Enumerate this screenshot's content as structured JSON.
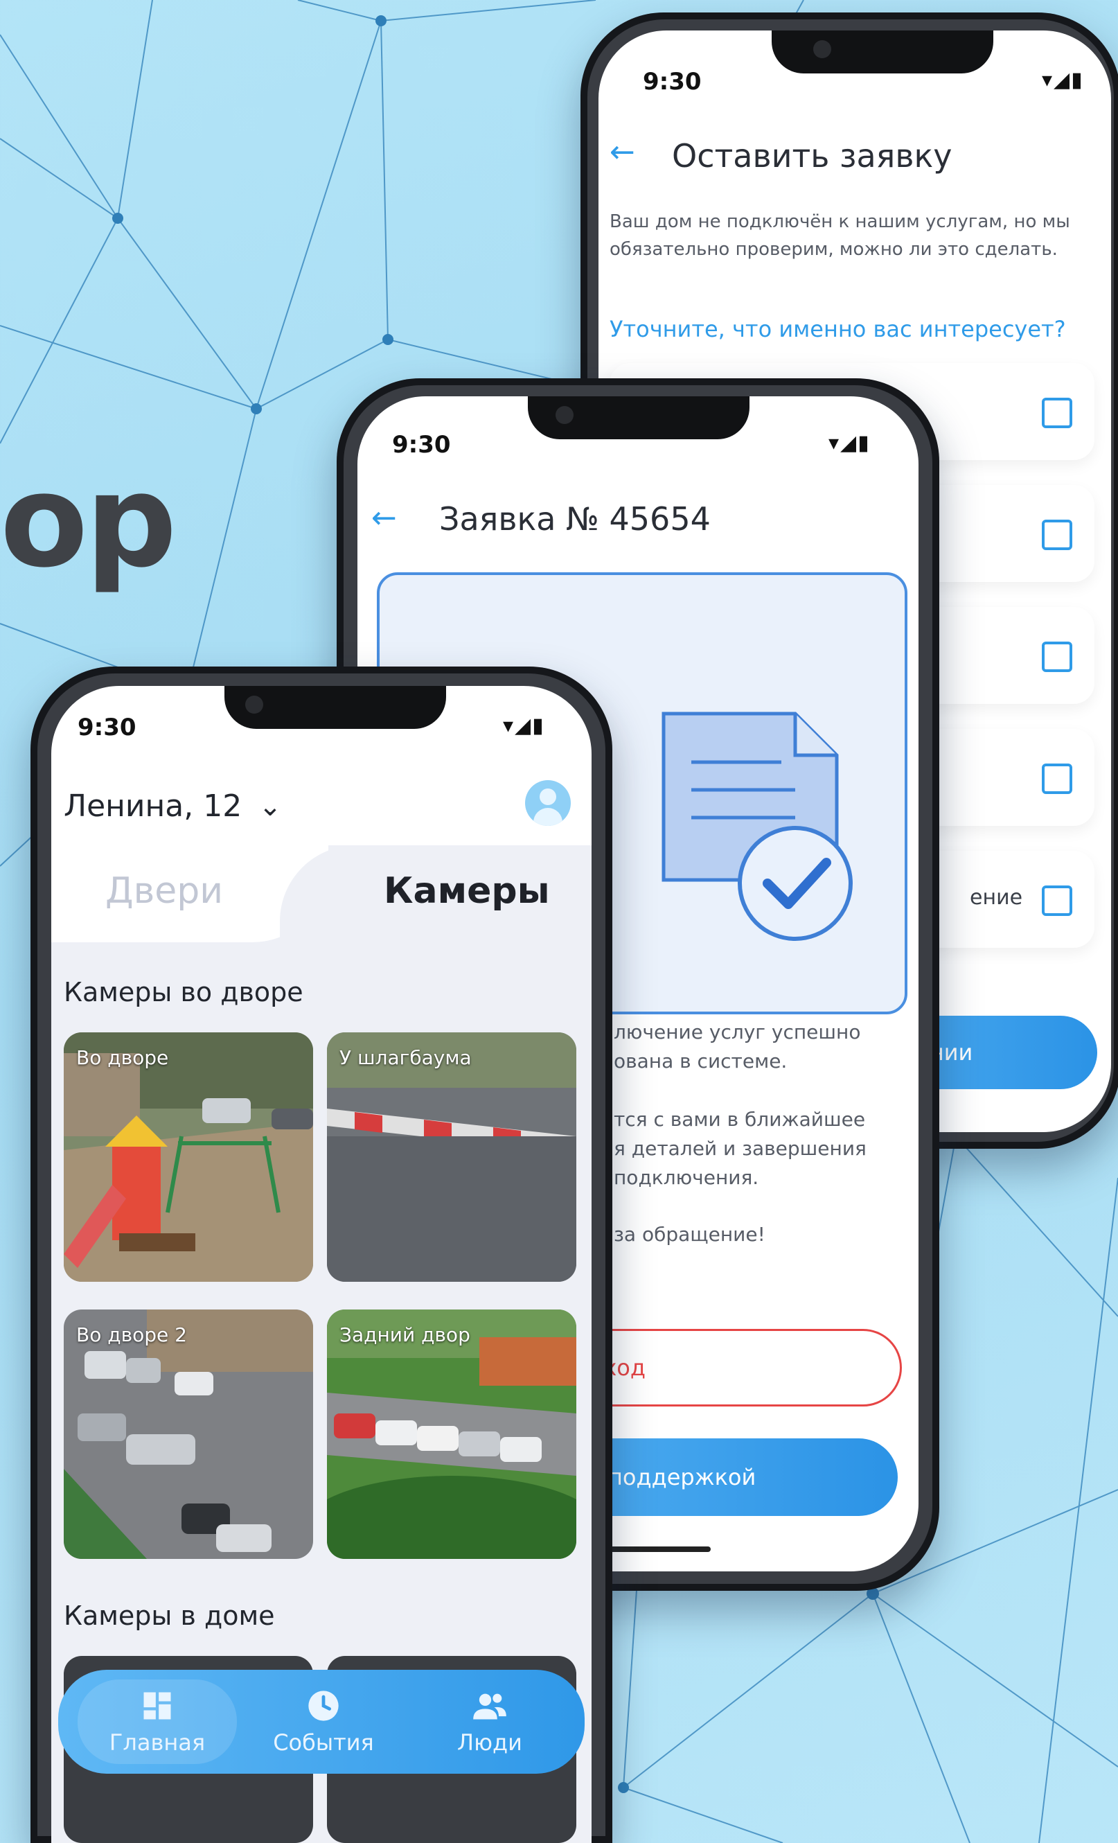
{
  "background_text": "ор",
  "phone_back": {
    "time": "9:30",
    "status_icons": "wifi-signal-battery",
    "title": "Оставить заявку",
    "description": "Ваш дом не подключён к нашим услугам, но мы обязательно проверим, можно ли это сделать.",
    "question": "Уточните, что именно вас интересует?",
    "option_partial": "ение",
    "button_partial": "очении"
  },
  "phone_middle": {
    "time": "9:30",
    "status_icons": "wifi-signal-battery",
    "title": "Заявка № 45654",
    "text_line1": "лючение услуг успешно",
    "text_line2": "ована в системе.",
    "text_line3": "тся с вами в ближайшее",
    "text_line4": "я деталей и завершения",
    "text_line5": "подключения.",
    "text_line6": "за обращение!",
    "exit_button": "ыход",
    "support_button": "техподдержкой"
  },
  "phone_front": {
    "time": "9:30",
    "status_icons": "wifi-signal-battery",
    "address": "Ленина, 12",
    "tabs": [
      "Двери",
      "Камеры"
    ],
    "section_yard": "Камеры во дворе",
    "cameras": [
      {
        "label": "Во дворе"
      },
      {
        "label": "У шлагбаума"
      },
      {
        "label": "Во дворе 2"
      },
      {
        "label": "Задний двор"
      }
    ],
    "section_house": "Камеры в доме",
    "nav": [
      {
        "label": "Главная",
        "icon": "dashboard-icon"
      },
      {
        "label": "События",
        "icon": "clock-icon"
      },
      {
        "label": "Люди",
        "icon": "people-icon"
      }
    ]
  },
  "colors": {
    "accent": "#2f9be8",
    "danger": "#e64545",
    "background": "#aee0f5"
  }
}
